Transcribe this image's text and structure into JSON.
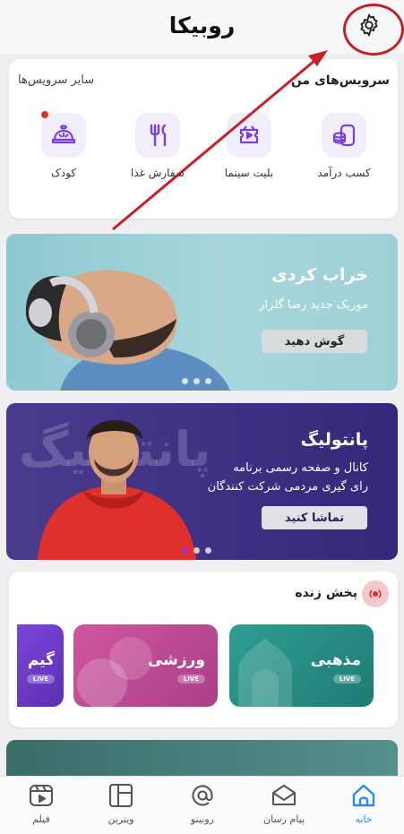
{
  "app": {
    "title": "روبیکا"
  },
  "services": {
    "my_title": "سرویس‌های من",
    "other_title": "سایر سرویس‌ها",
    "items": [
      {
        "label": "کسب درآمد",
        "icon": "coins-icon"
      },
      {
        "label": "بلیت سینما",
        "icon": "cinema-ticket-icon"
      },
      {
        "label": "سفارش غذا",
        "icon": "fork-knife-icon"
      },
      {
        "label": "کودک",
        "icon": "kid-hat-icon"
      }
    ]
  },
  "banners": [
    {
      "title": "خراب کردی",
      "subtitle": "موزیک جدید رضا گلزار",
      "button": "گوش دهید"
    },
    {
      "title": "پانتولیگ",
      "subtitle_lines": [
        "کانال و صفحه رسمی برنامه",
        "رای گیری مردمی شرکت کنندگان"
      ],
      "button": "تماشا کنید",
      "watermark": "پانتولیگ"
    }
  ],
  "live": {
    "title": "پخش زنده",
    "badge": "LIVE",
    "tiles": [
      {
        "label": "مذهبی",
        "color": "#2a9d8f"
      },
      {
        "label": "ورزشی",
        "color": "#c54a9c"
      },
      {
        "label": "گیم",
        "color": "#6f3cc9"
      }
    ]
  },
  "nav": {
    "items": [
      {
        "label": "خانه",
        "icon": "home-icon",
        "active": true
      },
      {
        "label": "پیام رسان",
        "icon": "envelope-icon"
      },
      {
        "label": "روبینو",
        "icon": "at-sign-icon"
      },
      {
        "label": "ویترین",
        "icon": "grid-icon"
      },
      {
        "label": "فیلم",
        "icon": "film-icon"
      }
    ]
  },
  "colors": {
    "accent": "#7b3fd9",
    "nav_active": "#2b8ce8",
    "annotation": "#c4202a"
  }
}
